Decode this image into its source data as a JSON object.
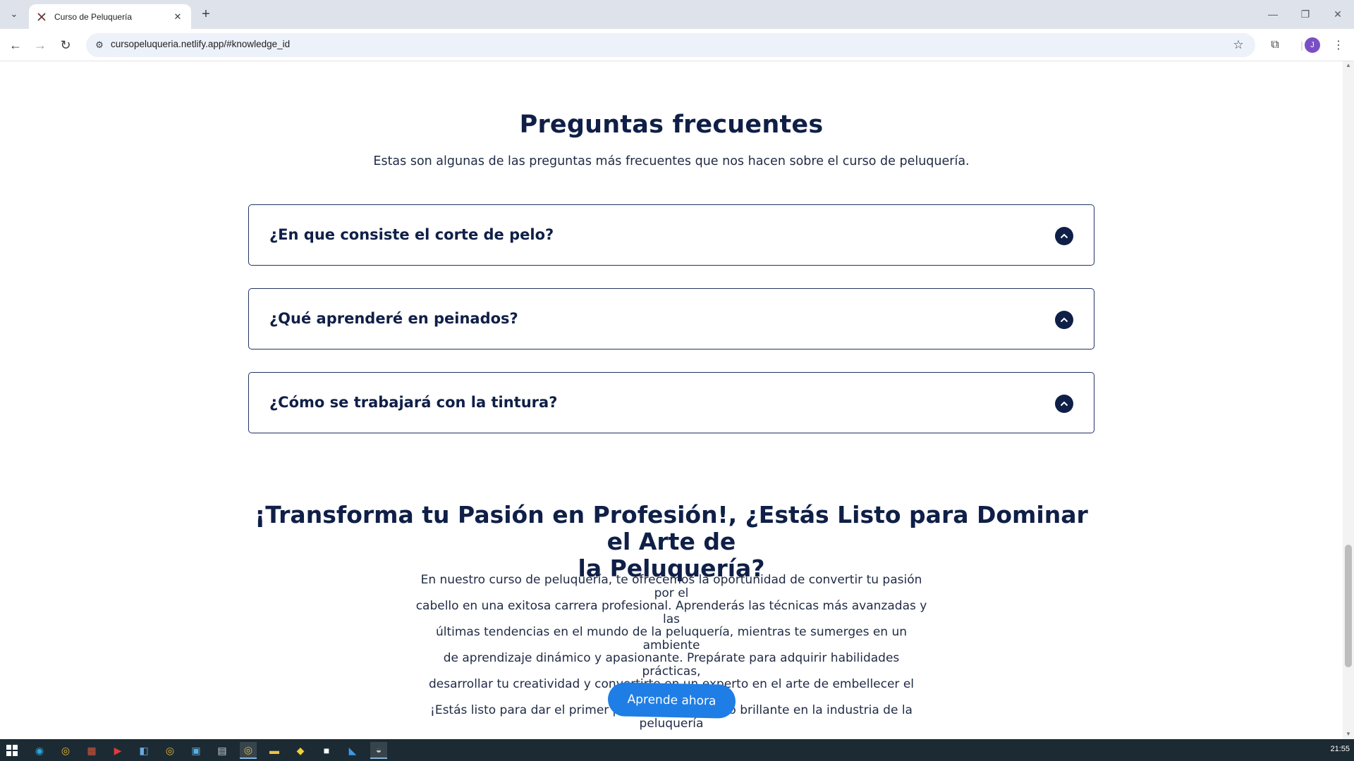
{
  "browser": {
    "tab_title": "Curso de Peluquería",
    "url": "cursopeluqueria.netlify.app/#knowledge_id",
    "profile_initial": "J"
  },
  "faq": {
    "title": "Preguntas frecuentes",
    "subtitle": "Estas son algunas de las preguntas más frecuentes que nos hacen sobre el curso de peluquería.",
    "items": [
      {
        "question": "¿En que consiste el corte de pelo?"
      },
      {
        "question": "¿Qué aprenderé en peinados?"
      },
      {
        "question": "¿Cómo se trabajará con la tintura?"
      }
    ]
  },
  "cta": {
    "title_line1": "¡Transforma tu Pasión en Profesión!, ¿Estás Listo para Dominar el Arte de",
    "title_line2": "la Peluquería?",
    "body_lines": [
      "En nuestro curso de peluquería, te ofrecemos la oportunidad de convertir tu pasión por el",
      "cabello en una exitosa carrera profesional. Aprenderás las técnicas más avanzadas y las",
      "últimas tendencias en el mundo de la peluquería, mientras te sumerges en un ambiente",
      "de aprendizaje dinámico y apasionante. Prepárate para adquirir habilidades prácticas,",
      "desarrollar tu creatividad y convertirte en un experto en el arte de embellecer el cabello.",
      "¡Estás listo para dar el primer paso hacia un futuro brillante en la industria de la",
      "peluquería"
    ],
    "button_label": "Aprende ahora"
  },
  "taskbar": {
    "clock": "21:55"
  },
  "colors": {
    "heading": "#0f1f47",
    "accent_button": "#1f7de6",
    "taskbar": "#1c2b33"
  }
}
